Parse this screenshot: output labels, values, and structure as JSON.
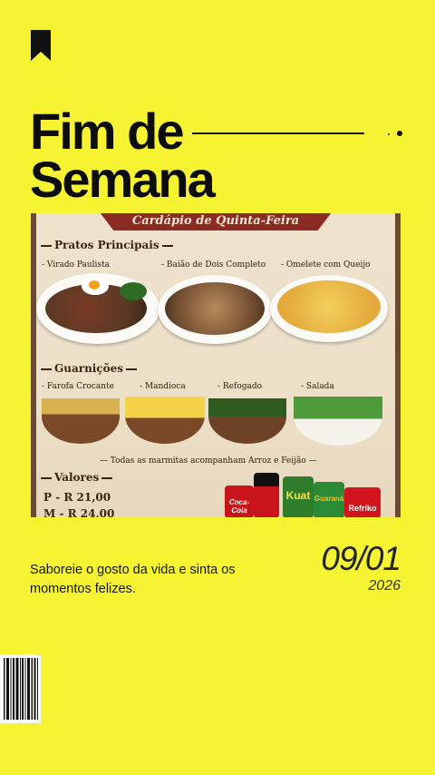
{
  "header": {
    "title_line1": "Fim de",
    "title_line2": "Semana"
  },
  "menu_image": {
    "banner": "Cardápio de Quinta-Feira",
    "pratos_principais": {
      "heading": "Pratos Principais",
      "items": [
        "Virado Paulista",
        "Baião de Dois Completo",
        "Omelete com Queijo"
      ]
    },
    "guarnicoes": {
      "heading": "Guarnições",
      "items": [
        "Farofa Crocante",
        "Mandioca",
        "Refogado",
        "Salada"
      ]
    },
    "note": "Todas as marmitas acompanham Arroz e Feijão",
    "valores": {
      "heading": "Valores",
      "prices": [
        "P - R 21,00",
        "M - R 24,00"
      ]
    },
    "drinks": [
      "Coca-Cola",
      "Kuat",
      "Guaraná",
      "Refriko"
    ]
  },
  "tagline": "Saboreie o gosto da vida e sinta os momentos felizes.",
  "date": {
    "day_month": "09/01",
    "year": "2026"
  },
  "colors": {
    "background": "#f6f432",
    "text": "#111111",
    "menu_accent": "#8c2a24"
  },
  "icons": {
    "top": "bookmark-icon",
    "bottom": "barcode-icon"
  }
}
